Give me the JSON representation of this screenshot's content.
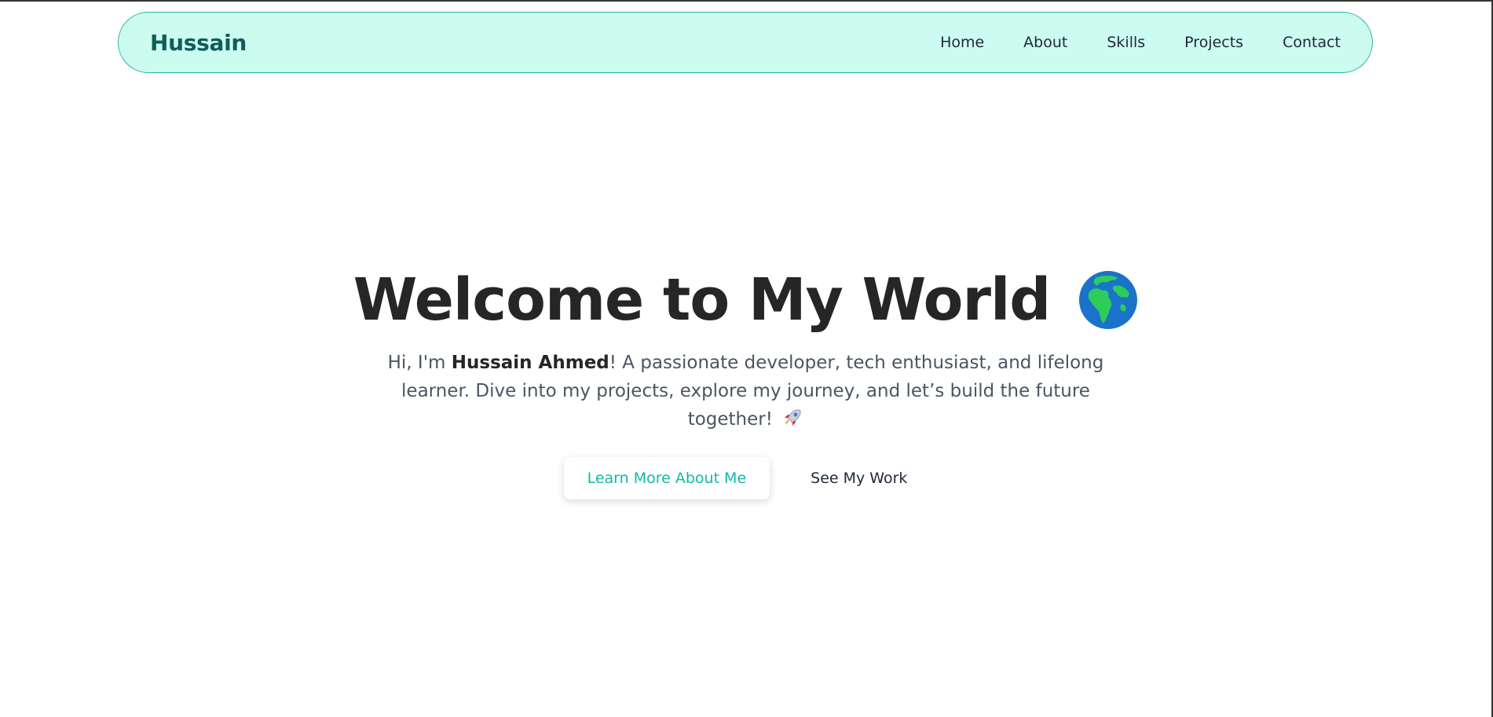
{
  "nav": {
    "brand": "Hussain",
    "links": [
      "Home",
      "About",
      "Skills",
      "Projects",
      "Contact"
    ]
  },
  "hero": {
    "title": "Welcome to My World",
    "title_icon": "globe-icon",
    "intro_prefix": "Hi, I'm ",
    "name": "Hussain Ahmed",
    "intro_suffix": "! A passionate developer, tech enthusiast, and lifelong learner. Dive into my projects, explore my journey, and let’s build the future together!",
    "text_icon": "rocket-icon",
    "primary_button": "Learn More About Me",
    "secondary_button": "See My Work"
  },
  "colors": {
    "nav_bg": "#ccfbef",
    "nav_border": "#2bb5a3",
    "brand": "#0f5d5b",
    "accent": "#14b8a6",
    "title": "#262626"
  }
}
